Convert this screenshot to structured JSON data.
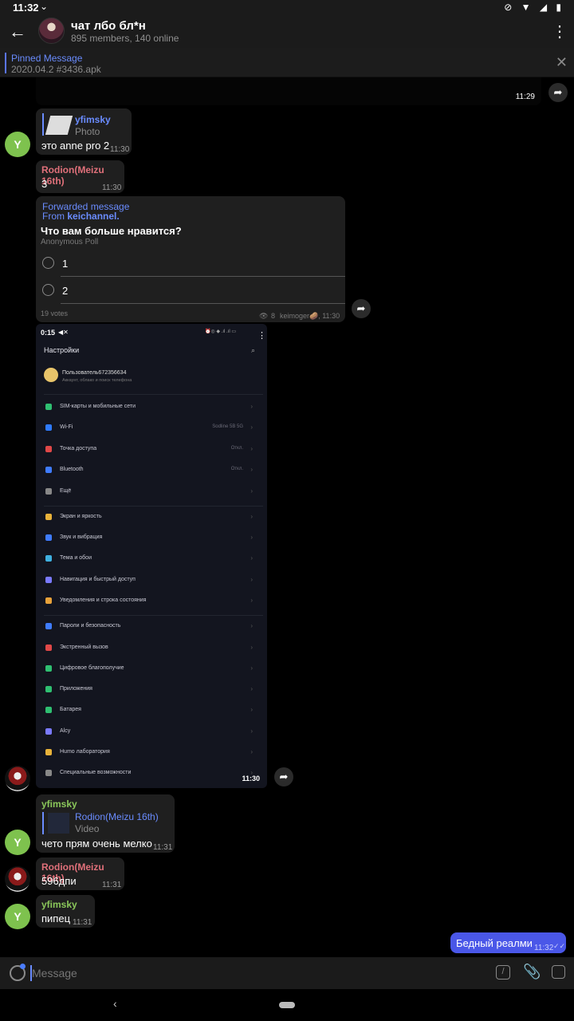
{
  "status_bar": {
    "time": "11:32",
    "icons": "⊘ ▼ ◢ ▮"
  },
  "header": {
    "title": "чат лбо бл*н",
    "subtitle": "895 members, 140 online"
  },
  "pinned": {
    "label": "Pinned Message",
    "text": "2020.04.2 #3436.apk"
  },
  "messages": {
    "video_top": {
      "time": "11:29"
    },
    "m1": {
      "reply_name": "yfimsky",
      "reply_type": "Photo",
      "text": "это anne pro 2",
      "time": "11:30"
    },
    "m2": {
      "name": "Rodion(Meizu 16th)",
      "text": "3",
      "time": "11:30"
    },
    "poll": {
      "forwarded": "Forwarded message",
      "from_label": "From",
      "from_channel": "keichannel.",
      "question": "Что вам больше нравится?",
      "kind": "Anonymous Poll",
      "options": [
        "1",
        "2"
      ],
      "votes": "19 votes",
      "views": "8",
      "author_time": "keimoger🥔, 11:30"
    },
    "screenshot": {
      "time_overlay": "0:15",
      "time": "11:30",
      "title": "Настройки",
      "account": {
        "name": "Пользователь672356634",
        "sub": "Аккаунт, облако и поиск телефона"
      },
      "rows": [
        {
          "label": "SIM-карты и мобильные сети",
          "value": ""
        },
        {
          "label": "Wi-Fi",
          "value": "Sodline 5B 5G"
        },
        {
          "label": "Точка доступа",
          "value": "Откл."
        },
        {
          "label": "Bluetooth",
          "value": "Откл."
        },
        {
          "label": "Ещё",
          "value": ""
        },
        {
          "label": "Экран и яркость",
          "value": ""
        },
        {
          "label": "Звук и вибрация",
          "value": ""
        },
        {
          "label": "Тема и обои",
          "value": ""
        },
        {
          "label": "Навигация и быстрый доступ",
          "value": ""
        },
        {
          "label": "Уведомления и строка состояния",
          "value": ""
        },
        {
          "label": "Пароли и безопасность",
          "value": ""
        },
        {
          "label": "Экстренный вызов",
          "value": ""
        },
        {
          "label": "Цифровое благополучие",
          "value": ""
        },
        {
          "label": "Приложения",
          "value": ""
        },
        {
          "label": "Батарея",
          "value": ""
        },
        {
          "label": "Alcy",
          "value": ""
        },
        {
          "label": "Humo лаборатория",
          "value": ""
        },
        {
          "label": "Специальные возможности",
          "value": ""
        }
      ]
    },
    "m3": {
      "name": "yfimsky",
      "reply_name": "Rodion(Meizu 16th)",
      "reply_type": "Video",
      "text": "чето прям очень мелко",
      "time": "11:31"
    },
    "m4": {
      "name": "Rodion(Meizu 16th)",
      "text": "596дпи",
      "time": "11:31"
    },
    "m5": {
      "name": "yfimsky",
      "text": "пипец",
      "time": "11:31"
    },
    "out": {
      "text": "Бедный реалми",
      "time": "11:32"
    }
  },
  "composer": {
    "placeholder": "Message"
  },
  "avatar_letter": "Y",
  "colors": {
    "accent": "#6a8cff",
    "outgoing": "#4a57e8",
    "rodion": "#e0707a",
    "yfimsky": "#8ac75a"
  }
}
